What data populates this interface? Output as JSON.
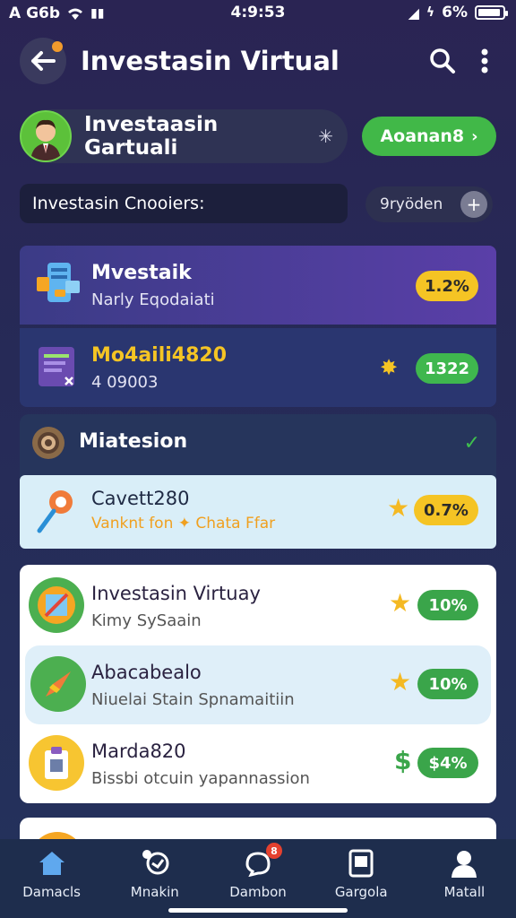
{
  "status": {
    "carrier": "A G6b",
    "time": "4:9:53",
    "battery": "6%"
  },
  "header": {
    "title": "Investasin Virtual"
  },
  "profile": {
    "name": "Investaasin Gartuali",
    "action_label": "Aoanan8"
  },
  "search": {
    "label": "Investasin Cnooiers:",
    "filter_label": "9ryöden"
  },
  "cards": [
    {
      "title": "Mvestaik",
      "subtitle": "Narly Eqodaiati",
      "badge": "1.2%",
      "badge_color": "#f5c424"
    },
    {
      "title": "Mo4aili4820",
      "subtitle": "4 09003",
      "badge": "1322",
      "badge_color": "#3fb74e"
    }
  ],
  "group": {
    "title": "Miatesion",
    "item": {
      "title": "Cavett280",
      "subtitle": "Vanknt fon ✦ Chata Ffar",
      "badge": "0.7%"
    }
  },
  "list": [
    {
      "title": "Investasin Virtuay",
      "subtitle": "Kimy SySaain",
      "badge": "10%",
      "marker": "star",
      "icon_color": "#f5a623"
    },
    {
      "title": "Abacabealo",
      "subtitle": "Niuelai Stain Spnamaitiin",
      "badge": "10%",
      "marker": "star",
      "icon_color": "#4caf50"
    },
    {
      "title": "Marda820",
      "subtitle": "Bissbi otcuin yapannassion",
      "badge": "$4%",
      "marker": "$",
      "icon_color": "#f7c531"
    }
  ],
  "nav": [
    {
      "label": "Damacls",
      "icon": "home-icon"
    },
    {
      "label": "Mnakin",
      "icon": "chart-icon"
    },
    {
      "label": "Dambon",
      "icon": "chat-icon",
      "badge": "8"
    },
    {
      "label": "Gargola",
      "icon": "tablet-icon"
    },
    {
      "label": "Matall",
      "icon": "user-icon"
    }
  ]
}
